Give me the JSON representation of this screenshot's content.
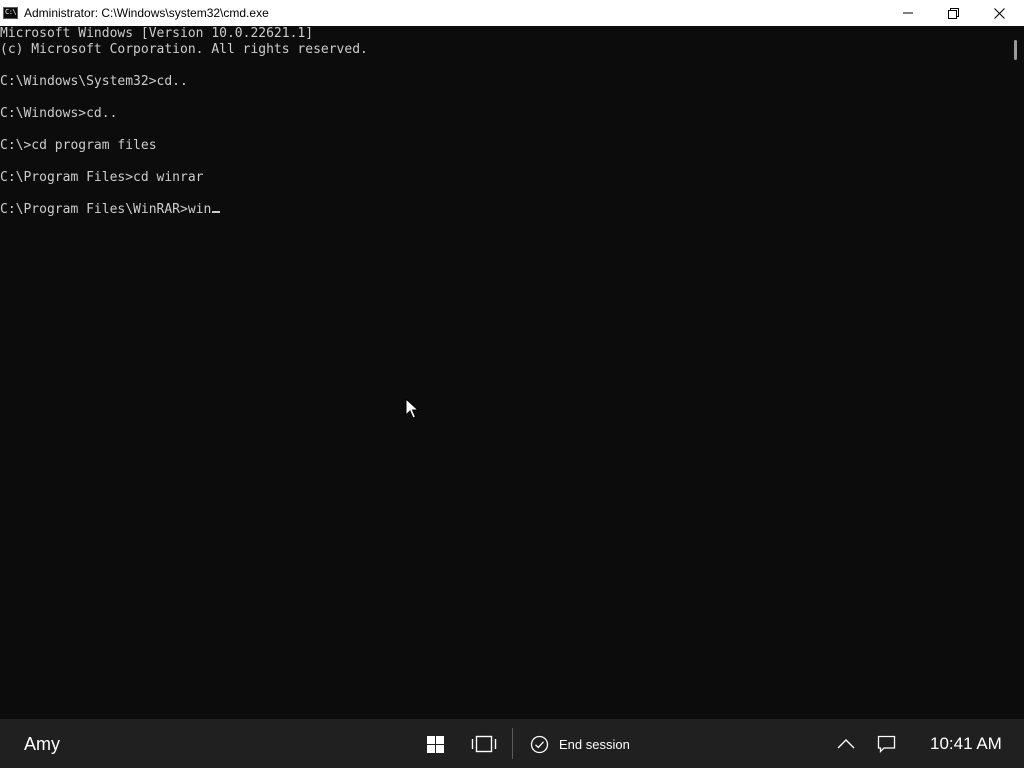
{
  "window": {
    "title": "Administrator: C:\\Windows\\system32\\cmd.exe",
    "icon": "cmd-icon",
    "icon_text": "C:\\",
    "controls": [
      "minimize-icon",
      "restore-icon",
      "close-icon"
    ]
  },
  "console": {
    "text_color": "#cccccc",
    "background": "#0c0c0c",
    "lines": [
      "Microsoft Windows [Version 10.0.22621.1]",
      "(c) Microsoft Corporation. All rights reserved.",
      "",
      "C:\\Windows\\System32>cd..",
      "",
      "C:\\Windows>cd..",
      "",
      "C:\\>cd program files",
      "",
      "C:\\Program Files>cd winrar",
      "",
      "C:\\Program Files\\WinRAR>win"
    ]
  },
  "taskbar": {
    "user_name": "Amy",
    "end_session_label": "End session",
    "clock": "10:41 AM",
    "background": "#202020",
    "icons": [
      "windows-start-icon",
      "task-view-icon",
      "check-circle-icon",
      "chevron-up-icon",
      "notification-icon"
    ]
  }
}
